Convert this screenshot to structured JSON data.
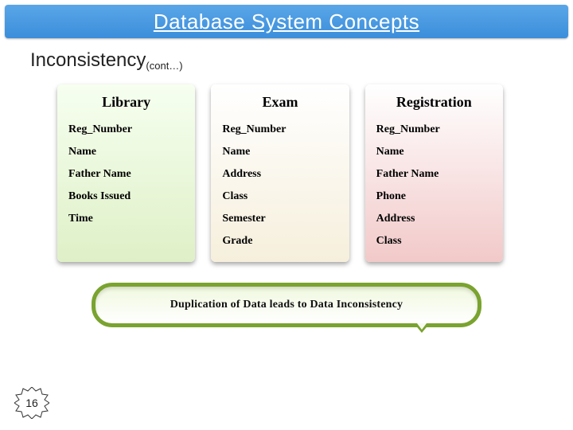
{
  "header": {
    "title": "Database System Concepts"
  },
  "subtitle": {
    "main": "Inconsistency",
    "suffix": "(cont…)"
  },
  "tables": {
    "library": {
      "title": "Library",
      "fields": [
        "Reg_Number",
        "Name",
        "Father Name",
        "Books Issued",
        "Time"
      ]
    },
    "exam": {
      "title": "Exam",
      "fields": [
        "Reg_Number",
        "Name",
        "Address",
        "Class",
        "Semester",
        "Grade"
      ]
    },
    "registration": {
      "title": "Registration",
      "fields": [
        "Reg_Number",
        "Name",
        "Father Name",
        "Phone",
        "Address",
        "Class"
      ]
    }
  },
  "callout": {
    "text": "Duplication of Data leads to Data Inconsistency"
  },
  "page": {
    "number": "16"
  },
  "colors": {
    "accent": "#3b8edb",
    "callout_border": "#7aa32f"
  }
}
